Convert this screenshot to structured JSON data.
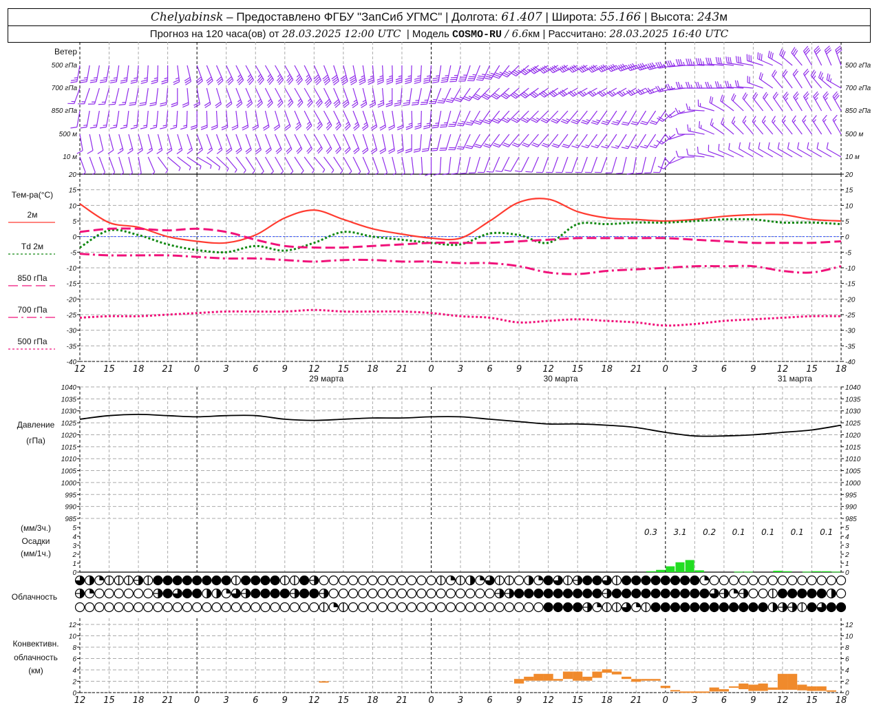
{
  "header": {
    "city": "Chelyabinsk",
    "provider": " – Предоставлено ФГБУ \"ЗапСиб УГМС\" | ",
    "lon_label": "Долгота: ",
    "lon": "61.407",
    "lat_label": " | Широта: ",
    "lat": "55.166",
    "alt_label": " | Высота: ",
    "alt": "243",
    "alt_unit": "м",
    "forecast_label": "Прогноз на 120 часа(ов) от ",
    "forecast_start": "28.03.2025 12:00 UTC",
    "model_label": "  | Модель ",
    "model": "COSMO-RU",
    "model_sep": " / ",
    "resolution": "6.6",
    "resolution_unit": "км",
    "calc_label": " | Рассчитано: ",
    "calc_time": "28.03.2025 16:40 UTC"
  },
  "panels": {
    "wind": {
      "title": "Ветер",
      "levels": [
        "500 гПа",
        "700 гПа",
        "850 гПа",
        "500 м",
        "10 м"
      ]
    },
    "temperature": {
      "title": "Тем-ра(°С)",
      "legend": [
        "2м",
        "Td  2м",
        "850 гПа",
        "700 гПа",
        "500 гПа"
      ]
    },
    "pressure": {
      "title": "Давление",
      "unit": "(гПа)"
    },
    "precipitation": {
      "unit3h": "(мм/3ч.)",
      "title": "Осадки",
      "unit1h": "(мм/1ч.)"
    },
    "clouds": {
      "title": "Облачность"
    },
    "convective": {
      "title1": "Конвективн.",
      "title2": "облачность",
      "unit": "(км)"
    }
  },
  "axis": {
    "time_labels": [
      "12",
      "15",
      "18",
      "21",
      "0",
      "3",
      "6",
      "9",
      "12",
      "15",
      "18",
      "21",
      "0",
      "3",
      "6",
      "9",
      "12",
      "15",
      "18",
      "21",
      "0",
      "3",
      "6",
      "9",
      "12",
      "15",
      "18"
    ],
    "date_labels": [
      "29 марта",
      "30 марта",
      "31 марта"
    ]
  },
  "colors": {
    "wind": "#8f2bea",
    "t2m": "#ff3b30",
    "td2m": "#118811",
    "upper_air": "#f0127a",
    "zero_line": "#3050ff",
    "precipitation": "#22dd22",
    "convective": "#f08a2c",
    "grid": "#aaaaaa"
  },
  "chart_data": {
    "x": [
      "2025-03-28T12:00",
      "2025-03-28T15:00",
      "2025-03-28T18:00",
      "2025-03-28T21:00",
      "2025-03-29T00:00",
      "2025-03-29T03:00",
      "2025-03-29T06:00",
      "2025-03-29T09:00",
      "2025-03-29T12:00",
      "2025-03-29T15:00",
      "2025-03-29T18:00",
      "2025-03-29T21:00",
      "2025-03-30T00:00",
      "2025-03-30T03:00",
      "2025-03-30T06:00",
      "2025-03-30T09:00",
      "2025-03-30T12:00",
      "2025-03-30T15:00",
      "2025-03-30T18:00",
      "2025-03-30T21:00",
      "2025-03-31T00:00",
      "2025-03-31T03:00",
      "2025-03-31T06:00",
      "2025-03-31T09:00",
      "2025-03-31T12:00",
      "2025-03-31T15:00",
      "2025-03-31T18:00"
    ],
    "wind": {
      "type": "wind-barbs",
      "levels": [
        {
          "name": "500 гПа",
          "direction": [
            190,
            190,
            185,
            180,
            160,
            155,
            150,
            150,
            155,
            165,
            175,
            180,
            185,
            195,
            205,
            225,
            240,
            245,
            245,
            250,
            255,
            270,
            275,
            280,
            300,
            330,
            340
          ],
          "speed": [
            12,
            12,
            13,
            13,
            15,
            16,
            17,
            18,
            19,
            20,
            18,
            17,
            17,
            17,
            18,
            18,
            19,
            20,
            20,
            20,
            19,
            17,
            16,
            15,
            14,
            14,
            15
          ]
        },
        {
          "name": "700 гПа",
          "direction": [
            200,
            195,
            190,
            185,
            170,
            160,
            155,
            150,
            150,
            160,
            170,
            185,
            195,
            210,
            225,
            230,
            235,
            240,
            240,
            240,
            250,
            270,
            270,
            275,
            320,
            330,
            300
          ],
          "speed": [
            8,
            8,
            9,
            9,
            10,
            11,
            12,
            13,
            14,
            14,
            12,
            12,
            13,
            13,
            14,
            15,
            15,
            14,
            13,
            12,
            12,
            12,
            12,
            11,
            10,
            11,
            13
          ]
        },
        {
          "name": "850 гПа",
          "direction": [
            190,
            190,
            185,
            185,
            180,
            175,
            170,
            160,
            150,
            155,
            165,
            175,
            185,
            200,
            215,
            225,
            225,
            220,
            215,
            210,
            215,
            260,
            300,
            320,
            325,
            330,
            330
          ],
          "speed": [
            6,
            7,
            8,
            8,
            9,
            9,
            10,
            11,
            12,
            12,
            11,
            11,
            12,
            13,
            13,
            13,
            13,
            12,
            12,
            11,
            10,
            8,
            9,
            10,
            11,
            12,
            14
          ]
        },
        {
          "name": "500 м",
          "direction": [
            170,
            165,
            165,
            165,
            160,
            160,
            160,
            155,
            150,
            155,
            165,
            175,
            190,
            200,
            215,
            220,
            220,
            215,
            215,
            210,
            215,
            270,
            305,
            320,
            320,
            325,
            330
          ],
          "speed": [
            5,
            6,
            7,
            7,
            8,
            9,
            9,
            10,
            10,
            10,
            9,
            9,
            10,
            10,
            10,
            10,
            10,
            9,
            8,
            8,
            7,
            6,
            7,
            8,
            8,
            8,
            8
          ]
        },
        {
          "name": "10 м",
          "direction": [
            160,
            160,
            170,
            130,
            120,
            140,
            150,
            150,
            140,
            150,
            160,
            170,
            180,
            190,
            200,
            210,
            200,
            200,
            200,
            190,
            200,
            270,
            290,
            300,
            300,
            300,
            300
          ],
          "speed": [
            3,
            3,
            3,
            3,
            3,
            3,
            3,
            3,
            3,
            3,
            3,
            3,
            4,
            4,
            4,
            4,
            4,
            4,
            4,
            4,
            4,
            4,
            5,
            5,
            5,
            4,
            4
          ]
        }
      ]
    },
    "temperature": {
      "type": "line",
      "ylabel": "Тем-ра(°С)",
      "ylim": [
        -40,
        20
      ],
      "y_ticks": [
        20,
        15,
        10,
        5,
        0,
        -5,
        -10,
        -15,
        -20,
        -25,
        -30,
        -35,
        -40
      ],
      "grid": true,
      "series": [
        {
          "name": "2м",
          "values": [
            10.5,
            4.5,
            3,
            0,
            -1.5,
            -2,
            0.5,
            6,
            8.5,
            5.5,
            2.5,
            0.8,
            -0.5,
            -0.5,
            5,
            11,
            12,
            8,
            6,
            5.5,
            5,
            5.5,
            6.5,
            7,
            7,
            5.5,
            5
          ]
        },
        {
          "name": "Td  2м",
          "values": [
            -3.5,
            2,
            0.5,
            -2.5,
            -4.3,
            -5,
            -3,
            -4.5,
            -2,
            1.5,
            0,
            -1,
            -2,
            -2.5,
            1,
            0.5,
            -2,
            4,
            4,
            4.5,
            4.5,
            5,
            5.5,
            5.5,
            4.5,
            4.5,
            4
          ]
        },
        {
          "name": "850 гПа",
          "values": [
            1.5,
            2.5,
            2.5,
            2,
            2.5,
            1.5,
            -1,
            -3,
            -3.5,
            -3.5,
            -3,
            -2.5,
            -2,
            -2,
            -2,
            -1.5,
            -1,
            -0.5,
            -0.5,
            -0.5,
            -0.5,
            -1,
            -1.5,
            -2,
            -2,
            -2,
            -1.5
          ]
        },
        {
          "name": "700 гПа",
          "values": [
            -5.5,
            -6,
            -6,
            -6,
            -6.5,
            -7,
            -7,
            -7.5,
            -8,
            -7.5,
            -7.5,
            -8,
            -8,
            -8.5,
            -8.5,
            -9.5,
            -11.5,
            -12,
            -11,
            -10.5,
            -10,
            -9.5,
            -9.5,
            -9.5,
            -11,
            -11.5,
            -9.5
          ]
        },
        {
          "name": "500 гПа",
          "values": [
            -26,
            -25.5,
            -25.5,
            -25,
            -24.5,
            -24,
            -24,
            -24,
            -23.5,
            -24,
            -24,
            -24,
            -24.5,
            -25.5,
            -26,
            -27.5,
            -27,
            -26.5,
            -27,
            -27.5,
            -28.5,
            -28,
            -27,
            -26.5,
            -26,
            -25.5,
            -25.5
          ]
        }
      ]
    },
    "pressure": {
      "type": "line",
      "ylabel": "Давление (гПа)",
      "ylim": [
        985,
        1040
      ],
      "y_ticks": [
        1040,
        1035,
        1030,
        1025,
        1020,
        1015,
        1010,
        1005,
        1000,
        995,
        990,
        985
      ],
      "grid": true,
      "values": [
        1026.5,
        1028,
        1028.5,
        1028,
        1027.5,
        1028,
        1028,
        1026.5,
        1026,
        1026.5,
        1027,
        1027,
        1027.5,
        1027.5,
        1026.5,
        1025.5,
        1024.5,
        1024.5,
        1024,
        1023,
        1021,
        1019.5,
        1019.5,
        1020,
        1021,
        1022,
        1024
      ]
    },
    "precipitation": {
      "type": "bar",
      "ylim": [
        0,
        5
      ],
      "y_ticks": [
        0,
        1,
        2,
        3,
        4,
        5
      ],
      "hourly": [
        [
          "2025-03-30T22:00",
          0.1
        ],
        [
          "2025-03-30T23:00",
          0.25
        ],
        [
          "2025-03-31T00:00",
          0.65
        ],
        [
          "2025-03-31T01:00",
          1.1
        ],
        [
          "2025-03-31T02:00",
          1.35
        ],
        [
          "2025-03-31T03:00",
          0.2
        ],
        [
          "2025-03-31T07:00",
          0.05
        ],
        [
          "2025-03-31T08:00",
          0.05
        ],
        [
          "2025-03-31T11:00",
          0.15
        ],
        [
          "2025-03-31T12:00",
          0.1
        ],
        [
          "2025-03-31T14:00",
          0.05
        ],
        [
          "2025-03-31T15:00",
          0.1
        ],
        [
          "2025-03-31T16:00",
          0.1
        ],
        [
          "2025-03-31T17:00",
          0.05
        ]
      ],
      "totals_3h": [
        [
          "2025-03-30T21:00",
          0.3
        ],
        [
          "2025-03-31T00:00",
          3.1
        ],
        [
          "2025-03-31T03:00",
          0.2
        ],
        [
          "2025-03-31T06:00",
          0.1
        ],
        [
          "2025-03-31T09:00",
          0.1
        ],
        [
          "2025-03-31T12:00",
          0.1
        ],
        [
          "2025-03-31T15:00",
          0.1
        ]
      ]
    },
    "cloud_cover": {
      "type": "symbols",
      "start": "2025-03-28T12:00",
      "scale": "eighths",
      "rows": [
        [
          6,
          4,
          2,
          1,
          1,
          1,
          5,
          1,
          8,
          8,
          8,
          8,
          8,
          8,
          8,
          8,
          1,
          8,
          8,
          8,
          8,
          1,
          1,
          8,
          5,
          0,
          0,
          0,
          0,
          0,
          0,
          0,
          0,
          0,
          0,
          0,
          0,
          1,
          2,
          1,
          4,
          2,
          6,
          1,
          1,
          0,
          4,
          2,
          8,
          6,
          1,
          5,
          8,
          8,
          6,
          1,
          8,
          8,
          8,
          8,
          8,
          8,
          8,
          8,
          2,
          0,
          0,
          0,
          0,
          0,
          0,
          0,
          0,
          0,
          0,
          0,
          0,
          0,
          0
        ],
        [
          5,
          2,
          0,
          0,
          0,
          0,
          0,
          0,
          5,
          8,
          6,
          8,
          8,
          4,
          4,
          2,
          6,
          5,
          8,
          8,
          8,
          8,
          5,
          8,
          8,
          5,
          0,
          0,
          0,
          0,
          0,
          0,
          0,
          0,
          0,
          0,
          0,
          0,
          0,
          0,
          0,
          0,
          0,
          5,
          5,
          8,
          8,
          8,
          8,
          8,
          8,
          8,
          8,
          8,
          5,
          8,
          8,
          8,
          8,
          8,
          8,
          8,
          8,
          8,
          8,
          6,
          5,
          2,
          5,
          0,
          0,
          1,
          8,
          8,
          8,
          8,
          8,
          4,
          0
        ],
        [
          0,
          0,
          0,
          0,
          0,
          0,
          0,
          0,
          0,
          0,
          0,
          0,
          0,
          0,
          0,
          0,
          0,
          0,
          0,
          0,
          0,
          0,
          0,
          0,
          0,
          1,
          2,
          1,
          0,
          0,
          0,
          0,
          0,
          0,
          0,
          0,
          0,
          0,
          0,
          0,
          0,
          0,
          0,
          0,
          0,
          0,
          0,
          0,
          8,
          8,
          8,
          8,
          5,
          2,
          1,
          1,
          6,
          2,
          1,
          8,
          8,
          8,
          8,
          8,
          8,
          8,
          8,
          8,
          8,
          8,
          8,
          4,
          5,
          5,
          1,
          8,
          6,
          8,
          8
        ]
      ]
    },
    "convective": {
      "type": "bar-range",
      "ylabel": "(км)",
      "ylim": [
        0,
        13
      ],
      "y_ticks": [
        0,
        2,
        4,
        6,
        8,
        10,
        12
      ],
      "grid": true,
      "bars": [
        [
          "2025-03-29T13:00",
          1.8,
          2.0
        ],
        [
          "2025-03-30T09:00",
          1.6,
          2.4
        ],
        [
          "2025-03-30T10:00",
          2.1,
          2.8
        ],
        [
          "2025-03-30T11:00",
          2.1,
          3.3
        ],
        [
          "2025-03-30T12:00",
          2.1,
          3.3
        ],
        [
          "2025-03-30T13:00",
          2.1,
          2.4
        ],
        [
          "2025-03-30T14:00",
          2.4,
          3.7
        ],
        [
          "2025-03-30T15:00",
          2.1,
          3.7
        ],
        [
          "2025-03-30T16:00",
          2.1,
          2.8
        ],
        [
          "2025-03-30T17:00",
          2.6,
          3.7
        ],
        [
          "2025-03-30T18:00",
          3.5,
          4.1
        ],
        [
          "2025-03-30T19:00",
          3.2,
          3.7
        ],
        [
          "2025-03-30T20:00",
          2.4,
          2.8
        ],
        [
          "2025-03-30T21:00",
          1.9,
          2.4
        ],
        [
          "2025-03-30T22:00",
          2.1,
          2.4
        ],
        [
          "2025-03-30T23:00",
          2.1,
          2.4
        ],
        [
          "2025-03-31T00:00",
          0.8,
          1.2
        ],
        [
          "2025-03-31T01:00",
          0.35,
          0.45
        ],
        [
          "2025-03-31T02:00",
          0.1,
          0.2
        ],
        [
          "2025-03-31T03:00",
          0.1,
          0.2
        ],
        [
          "2025-03-31T04:00",
          0.1,
          0.2
        ],
        [
          "2025-03-31T05:00",
          0.2,
          0.9
        ],
        [
          "2025-03-31T06:00",
          0.2,
          0.6
        ],
        [
          "2025-03-31T07:00",
          0.9,
          1.1
        ],
        [
          "2025-03-31T08:00",
          0.6,
          1.6
        ],
        [
          "2025-03-31T09:00",
          0.3,
          1.4
        ],
        [
          "2025-03-31T10:00",
          0.3,
          1.6
        ],
        [
          "2025-03-31T11:00",
          0.5,
          0.9
        ],
        [
          "2025-03-31T12:00",
          0.5,
          3.3
        ],
        [
          "2025-03-31T13:00",
          0.5,
          3.3
        ],
        [
          "2025-03-31T14:00",
          0.4,
          1.4
        ],
        [
          "2025-03-31T15:00",
          0.3,
          1.1
        ],
        [
          "2025-03-31T16:00",
          0.3,
          1.1
        ],
        [
          "2025-03-31T17:00",
          0.2,
          0.4
        ]
      ]
    }
  }
}
